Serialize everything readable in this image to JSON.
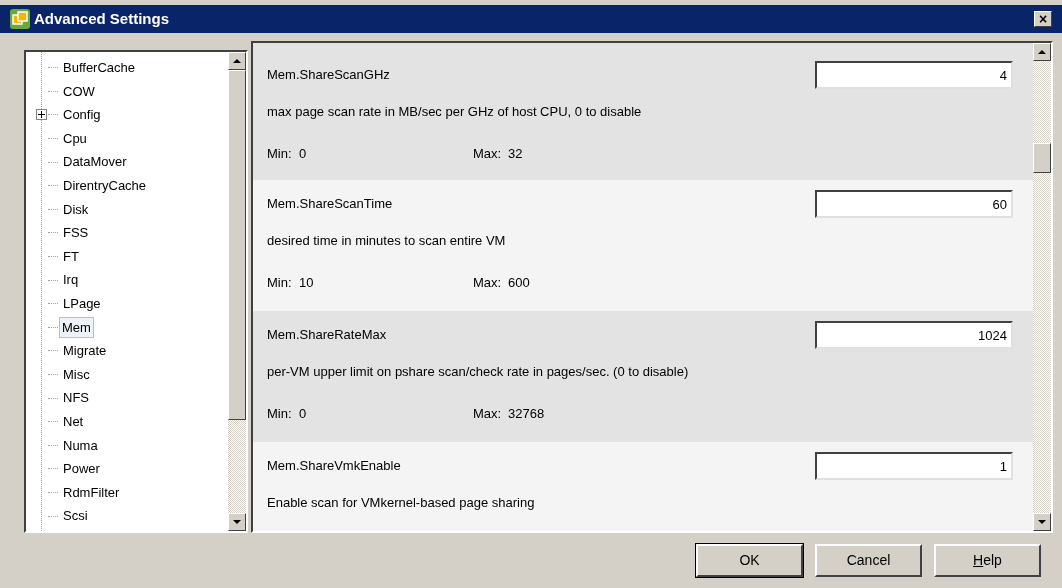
{
  "window": {
    "title": "Advanced Settings",
    "close_label": "×"
  },
  "tree": {
    "items": [
      {
        "label": "BufferCache",
        "selected": false,
        "expandable": false
      },
      {
        "label": "COW",
        "selected": false,
        "expandable": false
      },
      {
        "label": "Config",
        "selected": false,
        "expandable": true
      },
      {
        "label": "Cpu",
        "selected": false,
        "expandable": false
      },
      {
        "label": "DataMover",
        "selected": false,
        "expandable": false
      },
      {
        "label": "DirentryCache",
        "selected": false,
        "expandable": false
      },
      {
        "label": "Disk",
        "selected": false,
        "expandable": false
      },
      {
        "label": "FSS",
        "selected": false,
        "expandable": false
      },
      {
        "label": "FT",
        "selected": false,
        "expandable": false
      },
      {
        "label": "Irq",
        "selected": false,
        "expandable": false
      },
      {
        "label": "LPage",
        "selected": false,
        "expandable": false
      },
      {
        "label": "Mem",
        "selected": true,
        "expandable": false
      },
      {
        "label": "Migrate",
        "selected": false,
        "expandable": false
      },
      {
        "label": "Misc",
        "selected": false,
        "expandable": false
      },
      {
        "label": "NFS",
        "selected": false,
        "expandable": false
      },
      {
        "label": "Net",
        "selected": false,
        "expandable": false
      },
      {
        "label": "Numa",
        "selected": false,
        "expandable": false
      },
      {
        "label": "Power",
        "selected": false,
        "expandable": false
      },
      {
        "label": "RdmFilter",
        "selected": false,
        "expandable": false
      },
      {
        "label": "Scsi",
        "selected": false,
        "expandable": false
      }
    ]
  },
  "settings": [
    {
      "name": "Mem.ShareScanGHz",
      "value": "4",
      "description": "max page scan rate in MB/sec per GHz of host CPU, 0 to disable",
      "min_label": "Min:",
      "min": "0",
      "max_label": "Max:",
      "max": "32"
    },
    {
      "name": "Mem.ShareScanTime",
      "value": "60",
      "description": "desired time in minutes to scan entire VM",
      "min_label": "Min:",
      "min": "10",
      "max_label": "Max:",
      "max": "600"
    },
    {
      "name": "Mem.ShareRateMax",
      "value": "1024",
      "description": "per-VM upper limit on pshare scan/check rate in pages/sec. (0 to disable)",
      "min_label": "Min:",
      "min": "0",
      "max_label": "Max:",
      "max": "32768"
    },
    {
      "name": "Mem.ShareVmkEnable",
      "value": "1",
      "description": "Enable scan for VMkernel-based page sharing"
    }
  ],
  "buttons": [
    {
      "label": "OK",
      "default": true,
      "underline_first": false
    },
    {
      "label": "Cancel",
      "default": false,
      "underline_first": false
    },
    {
      "label": "Help",
      "default": false,
      "underline_first": true
    }
  ]
}
